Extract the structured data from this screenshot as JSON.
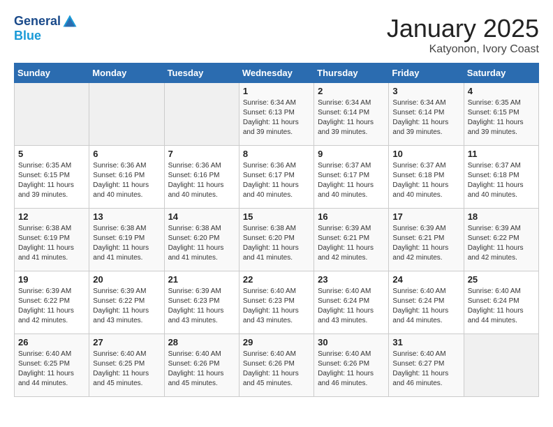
{
  "header": {
    "logo_line1": "General",
    "logo_line2": "Blue",
    "month_title": "January 2025",
    "location": "Katyonon, Ivory Coast"
  },
  "days_of_week": [
    "Sunday",
    "Monday",
    "Tuesday",
    "Wednesday",
    "Thursday",
    "Friday",
    "Saturday"
  ],
  "weeks": [
    [
      {
        "day": "",
        "sunrise": "",
        "sunset": "",
        "daylight": ""
      },
      {
        "day": "",
        "sunrise": "",
        "sunset": "",
        "daylight": ""
      },
      {
        "day": "",
        "sunrise": "",
        "sunset": "",
        "daylight": ""
      },
      {
        "day": "1",
        "sunrise": "Sunrise: 6:34 AM",
        "sunset": "Sunset: 6:13 PM",
        "daylight": "Daylight: 11 hours and 39 minutes."
      },
      {
        "day": "2",
        "sunrise": "Sunrise: 6:34 AM",
        "sunset": "Sunset: 6:14 PM",
        "daylight": "Daylight: 11 hours and 39 minutes."
      },
      {
        "day": "3",
        "sunrise": "Sunrise: 6:34 AM",
        "sunset": "Sunset: 6:14 PM",
        "daylight": "Daylight: 11 hours and 39 minutes."
      },
      {
        "day": "4",
        "sunrise": "Sunrise: 6:35 AM",
        "sunset": "Sunset: 6:15 PM",
        "daylight": "Daylight: 11 hours and 39 minutes."
      }
    ],
    [
      {
        "day": "5",
        "sunrise": "Sunrise: 6:35 AM",
        "sunset": "Sunset: 6:15 PM",
        "daylight": "Daylight: 11 hours and 39 minutes."
      },
      {
        "day": "6",
        "sunrise": "Sunrise: 6:36 AM",
        "sunset": "Sunset: 6:16 PM",
        "daylight": "Daylight: 11 hours and 40 minutes."
      },
      {
        "day": "7",
        "sunrise": "Sunrise: 6:36 AM",
        "sunset": "Sunset: 6:16 PM",
        "daylight": "Daylight: 11 hours and 40 minutes."
      },
      {
        "day": "8",
        "sunrise": "Sunrise: 6:36 AM",
        "sunset": "Sunset: 6:17 PM",
        "daylight": "Daylight: 11 hours and 40 minutes."
      },
      {
        "day": "9",
        "sunrise": "Sunrise: 6:37 AM",
        "sunset": "Sunset: 6:17 PM",
        "daylight": "Daylight: 11 hours and 40 minutes."
      },
      {
        "day": "10",
        "sunrise": "Sunrise: 6:37 AM",
        "sunset": "Sunset: 6:18 PM",
        "daylight": "Daylight: 11 hours and 40 minutes."
      },
      {
        "day": "11",
        "sunrise": "Sunrise: 6:37 AM",
        "sunset": "Sunset: 6:18 PM",
        "daylight": "Daylight: 11 hours and 40 minutes."
      }
    ],
    [
      {
        "day": "12",
        "sunrise": "Sunrise: 6:38 AM",
        "sunset": "Sunset: 6:19 PM",
        "daylight": "Daylight: 11 hours and 41 minutes."
      },
      {
        "day": "13",
        "sunrise": "Sunrise: 6:38 AM",
        "sunset": "Sunset: 6:19 PM",
        "daylight": "Daylight: 11 hours and 41 minutes."
      },
      {
        "day": "14",
        "sunrise": "Sunrise: 6:38 AM",
        "sunset": "Sunset: 6:20 PM",
        "daylight": "Daylight: 11 hours and 41 minutes."
      },
      {
        "day": "15",
        "sunrise": "Sunrise: 6:38 AM",
        "sunset": "Sunset: 6:20 PM",
        "daylight": "Daylight: 11 hours and 41 minutes."
      },
      {
        "day": "16",
        "sunrise": "Sunrise: 6:39 AM",
        "sunset": "Sunset: 6:21 PM",
        "daylight": "Daylight: 11 hours and 42 minutes."
      },
      {
        "day": "17",
        "sunrise": "Sunrise: 6:39 AM",
        "sunset": "Sunset: 6:21 PM",
        "daylight": "Daylight: 11 hours and 42 minutes."
      },
      {
        "day": "18",
        "sunrise": "Sunrise: 6:39 AM",
        "sunset": "Sunset: 6:22 PM",
        "daylight": "Daylight: 11 hours and 42 minutes."
      }
    ],
    [
      {
        "day": "19",
        "sunrise": "Sunrise: 6:39 AM",
        "sunset": "Sunset: 6:22 PM",
        "daylight": "Daylight: 11 hours and 42 minutes."
      },
      {
        "day": "20",
        "sunrise": "Sunrise: 6:39 AM",
        "sunset": "Sunset: 6:22 PM",
        "daylight": "Daylight: 11 hours and 43 minutes."
      },
      {
        "day": "21",
        "sunrise": "Sunrise: 6:39 AM",
        "sunset": "Sunset: 6:23 PM",
        "daylight": "Daylight: 11 hours and 43 minutes."
      },
      {
        "day": "22",
        "sunrise": "Sunrise: 6:40 AM",
        "sunset": "Sunset: 6:23 PM",
        "daylight": "Daylight: 11 hours and 43 minutes."
      },
      {
        "day": "23",
        "sunrise": "Sunrise: 6:40 AM",
        "sunset": "Sunset: 6:24 PM",
        "daylight": "Daylight: 11 hours and 43 minutes."
      },
      {
        "day": "24",
        "sunrise": "Sunrise: 6:40 AM",
        "sunset": "Sunset: 6:24 PM",
        "daylight": "Daylight: 11 hours and 44 minutes."
      },
      {
        "day": "25",
        "sunrise": "Sunrise: 6:40 AM",
        "sunset": "Sunset: 6:24 PM",
        "daylight": "Daylight: 11 hours and 44 minutes."
      }
    ],
    [
      {
        "day": "26",
        "sunrise": "Sunrise: 6:40 AM",
        "sunset": "Sunset: 6:25 PM",
        "daylight": "Daylight: 11 hours and 44 minutes."
      },
      {
        "day": "27",
        "sunrise": "Sunrise: 6:40 AM",
        "sunset": "Sunset: 6:25 PM",
        "daylight": "Daylight: 11 hours and 45 minutes."
      },
      {
        "day": "28",
        "sunrise": "Sunrise: 6:40 AM",
        "sunset": "Sunset: 6:26 PM",
        "daylight": "Daylight: 11 hours and 45 minutes."
      },
      {
        "day": "29",
        "sunrise": "Sunrise: 6:40 AM",
        "sunset": "Sunset: 6:26 PM",
        "daylight": "Daylight: 11 hours and 45 minutes."
      },
      {
        "day": "30",
        "sunrise": "Sunrise: 6:40 AM",
        "sunset": "Sunset: 6:26 PM",
        "daylight": "Daylight: 11 hours and 46 minutes."
      },
      {
        "day": "31",
        "sunrise": "Sunrise: 6:40 AM",
        "sunset": "Sunset: 6:27 PM",
        "daylight": "Daylight: 11 hours and 46 minutes."
      },
      {
        "day": "",
        "sunrise": "",
        "sunset": "",
        "daylight": ""
      }
    ]
  ]
}
